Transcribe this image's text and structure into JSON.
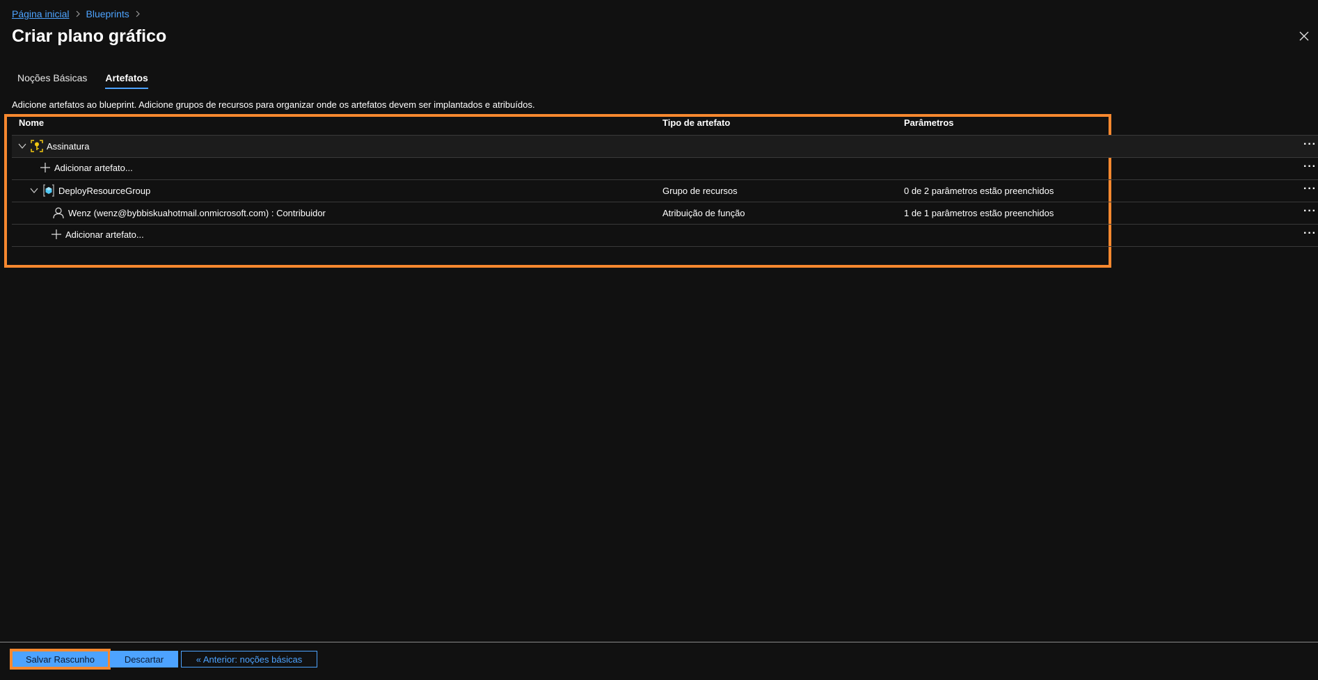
{
  "breadcrumb": {
    "home": "Página inicial",
    "blueprints": "Blueprints"
  },
  "page": {
    "title": "Criar plano gráfico"
  },
  "tabs": [
    {
      "label": "Noções Básicas",
      "active": false
    },
    {
      "label": "Artefatos",
      "active": true
    }
  ],
  "description": "Adicione artefatos ao blueprint. Adicione grupos de recursos para organizar onde os artefatos devem ser implantados e atribuídos.",
  "grid": {
    "headers": {
      "name": "Nome",
      "type": "Tipo de artefato",
      "params": "Parâmetros"
    },
    "rows": [
      {
        "name": "Assinatura",
        "type": "",
        "params": ""
      },
      {
        "name": "Adicionar artefato...",
        "type": "",
        "params": ""
      },
      {
        "name": "DeployResourceGroup",
        "type": "Grupo de recursos",
        "params": "0 de 2 parâmetros estão preenchidos"
      },
      {
        "name": "Wenz (wenz@bybbiskuahotmail.onmicrosoft.com) : Contribuidor",
        "type": "Atribuição de função",
        "params": "1 de 1 parâmetros estão preenchidos"
      },
      {
        "name": "Adicionar artefato...",
        "type": "",
        "params": ""
      }
    ],
    "more_label": "···"
  },
  "footer": {
    "save": "Salvar Rascunho",
    "discard": "Descartar",
    "previous": "« Anterior: noções básicas"
  },
  "colors": {
    "accent": "#4da3ff",
    "highlight": "#f7882f",
    "background": "#111111"
  }
}
